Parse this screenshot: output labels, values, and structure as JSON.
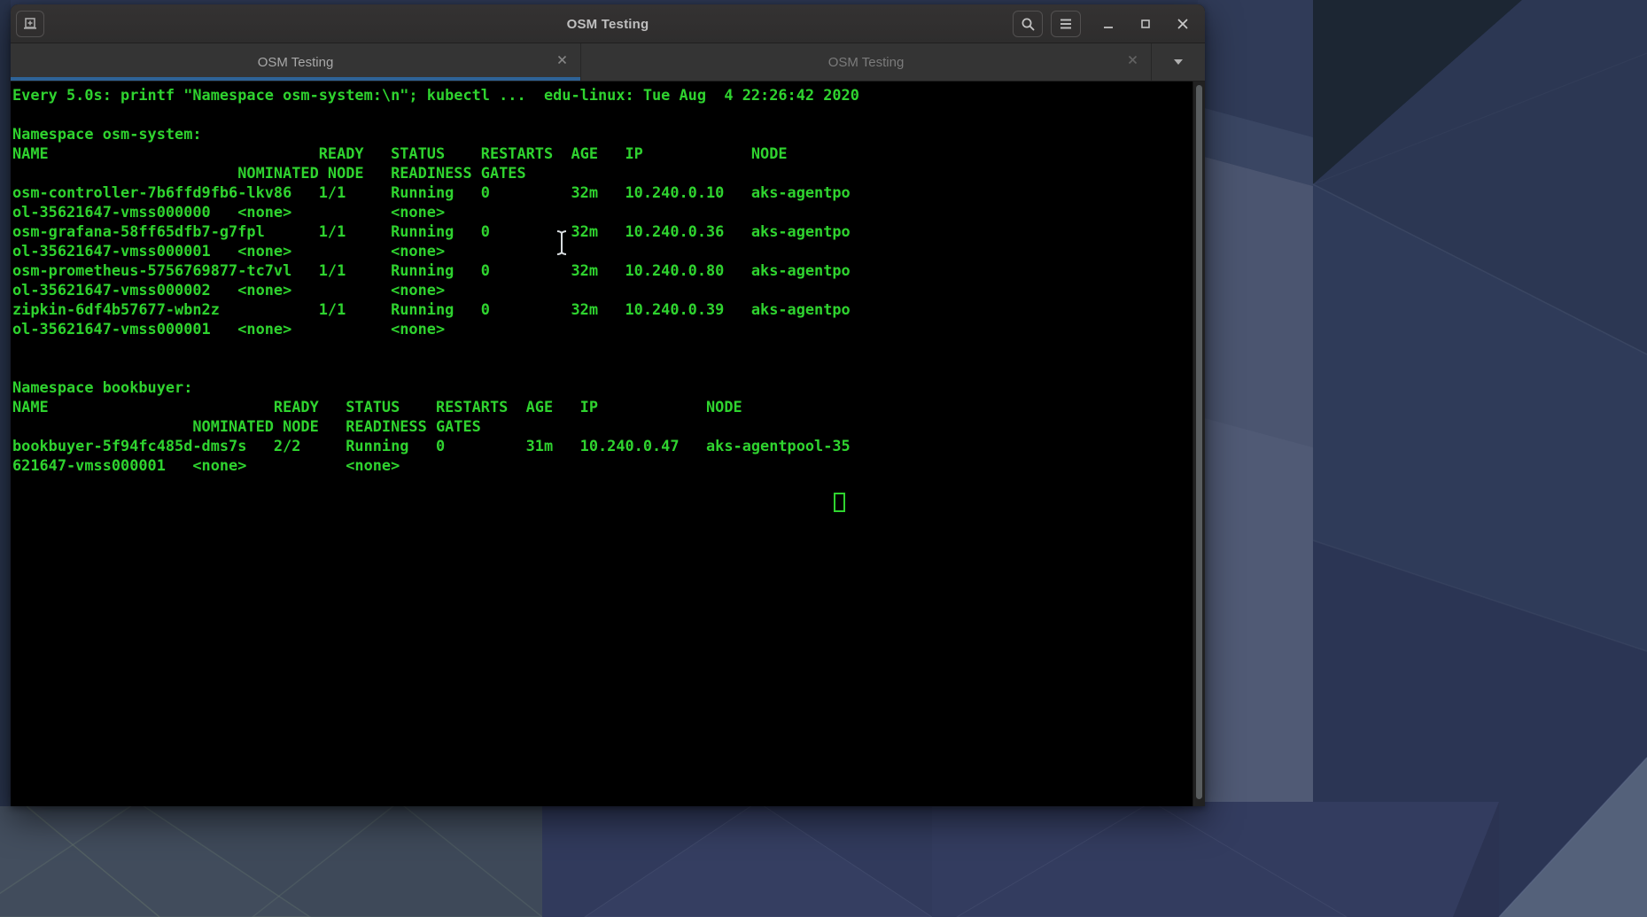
{
  "window": {
    "title": "OSM Testing"
  },
  "tabs": [
    {
      "label": "OSM Testing",
      "active": true
    },
    {
      "label": "OSM Testing",
      "active": false
    }
  ],
  "terminal": {
    "lines": [
      "Every 5.0s: printf \"Namespace osm-system:\\n\"; kubectl ...  edu-linux: Tue Aug  4 22:26:42 2020",
      "",
      "Namespace osm-system:",
      "NAME                              READY   STATUS    RESTARTS  AGE   IP            NODE",
      "                         NOMINATED NODE   READINESS GATES",
      "osm-controller-7b6ffd9fb6-lkv86   1/1     Running   0         32m   10.240.0.10   aks-agentpo",
      "ol-35621647-vmss000000   <none>           <none>",
      "osm-grafana-58ff65dfb7-g7fpl      1/1     Running   0         32m   10.240.0.36   aks-agentpo",
      "ol-35621647-vmss000001   <none>           <none>",
      "osm-prometheus-5756769877-tc7vl   1/1     Running   0         32m   10.240.0.80   aks-agentpo",
      "ol-35621647-vmss000002   <none>           <none>",
      "zipkin-6df4b57677-wbn2z           1/1     Running   0         32m   10.240.0.39   aks-agentpo",
      "ol-35621647-vmss000001   <none>           <none>",
      "",
      "",
      "Namespace bookbuyer:",
      "NAME                         READY   STATUS    RESTARTS  AGE   IP            NODE",
      "                    NOMINATED NODE   READINESS GATES",
      "bookbuyer-5f94fc485d-dms7s   2/2     Running   0         31m   10.240.0.47   aks-agentpool-35",
      "621647-vmss000001   <none>           <none>"
    ]
  },
  "colors": {
    "terminal_green": "#2fd32f",
    "terminal_bg": "#000000",
    "active_tab_underline": "#2e6397"
  }
}
